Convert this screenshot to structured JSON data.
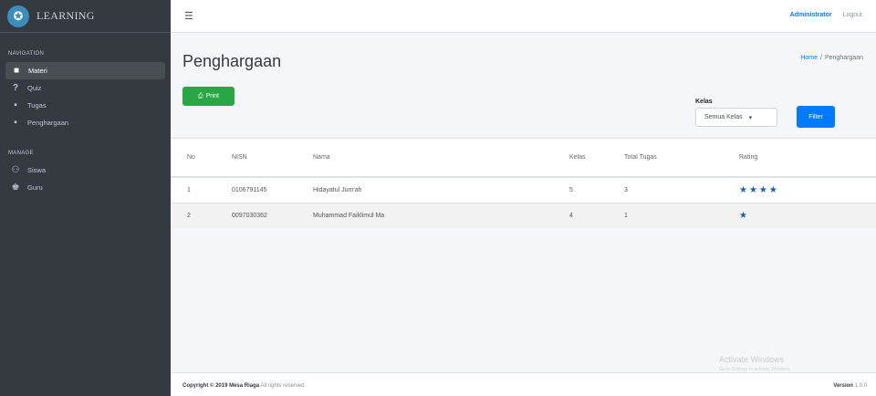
{
  "brand": {
    "name": "LEARNING"
  },
  "sidebar": {
    "nav_header": "NAVIGATION",
    "nav_items": [
      {
        "label": "Materi",
        "icon": "book-icon",
        "active": true
      },
      {
        "label": "Quiz",
        "icon": "question-icon"
      },
      {
        "label": "Tugas",
        "icon": "task-icon"
      },
      {
        "label": "Penghargaan",
        "icon": "award-icon"
      }
    ],
    "manage_header": "MANAGE",
    "manage_items": [
      {
        "label": "Siswa",
        "icon": "users-icon"
      },
      {
        "label": "Guru",
        "icon": "teacher-icon"
      }
    ]
  },
  "topbar": {
    "user": "Administrator",
    "logout": "Logout"
  },
  "page": {
    "title": "Penghargaan",
    "breadcrumb_home": "Home",
    "breadcrumb_sep": "/",
    "breadcrumb_current": "Penghargaan"
  },
  "toolbar": {
    "print_label": "Print"
  },
  "filter": {
    "label": "Kelas",
    "selected": "Semua Kelas",
    "button": "Filter"
  },
  "table": {
    "headers": [
      "No",
      "NISN",
      "Nama",
      "Kelas",
      "Total Tugas",
      "Rating"
    ],
    "rows": [
      {
        "no": "1",
        "nisn": "0106791145",
        "nama": "Hidayatul Jum'ah",
        "kelas": "5",
        "total": "3",
        "rating": 4
      },
      {
        "no": "2",
        "nisn": "0097030362",
        "nama": "Muhammad Faiklimul Ma",
        "kelas": "4",
        "total": "1",
        "rating": 1
      }
    ]
  },
  "footer": {
    "copyright": "Copyright © 2019 Mesa Riaga",
    "rights": "All rights reserved.",
    "version_label": "Version",
    "version": "1.0.0"
  },
  "watermark": {
    "title": "Activate Windows",
    "subtitle": "Go to Settings to activate Windows."
  },
  "colors": {
    "sidebar": "#343a40",
    "primary": "#007bff",
    "success": "#28a745",
    "star": "#1f5faa"
  }
}
